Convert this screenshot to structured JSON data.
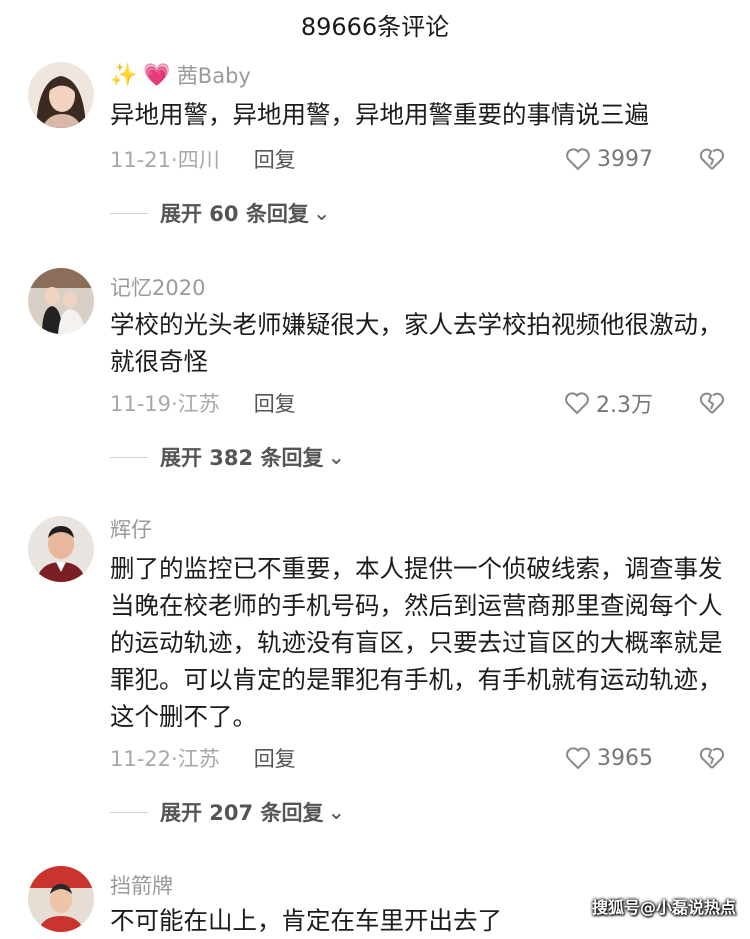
{
  "header": {
    "title": "89666条评论"
  },
  "comments": [
    {
      "username": "茜Baby",
      "username_prefix_icons": [
        "sparkle-icon",
        "pink-heart-icon"
      ],
      "text": "异地用警，异地用警，异地用警重要的事情说三遍",
      "date_location": "11-21·四川",
      "reply_label": "回复",
      "likes": "3997",
      "expand_label": "展开 60 条回复"
    },
    {
      "username": "记忆2020",
      "text": "学校的光头老师嫌疑很大，家人去学校拍视频他很激动，就很奇怪",
      "date_location": "11-19·江苏",
      "reply_label": "回复",
      "likes": "2.3万",
      "expand_label": "展开 382 条回复"
    },
    {
      "username": "辉仔",
      "text": "删了的监控已不重要，本人提供一个侦破线索，调查事发当晚在校老师的手机号码，然后到运营商那里查阅每个人的运动轨迹，轨迹没有盲区，只要去过盲区的大概率就是罪犯。可以肯定的是罪犯有手机，有手机就有运动轨迹，这个删不了。",
      "date_location": "11-22·江苏",
      "reply_label": "回复",
      "likes": "3965",
      "expand_label": "展开 207 条回复"
    },
    {
      "username": "挡箭牌",
      "text": "不可能在山上，肯定在车里开出去了"
    }
  ],
  "watermark": "搜狐号@小磊说热点",
  "colors": {
    "meta": "#a8a8a8",
    "username": "#9a9a9a",
    "text": "#1c1c1c",
    "heart_pink": "#ff5fa2"
  }
}
